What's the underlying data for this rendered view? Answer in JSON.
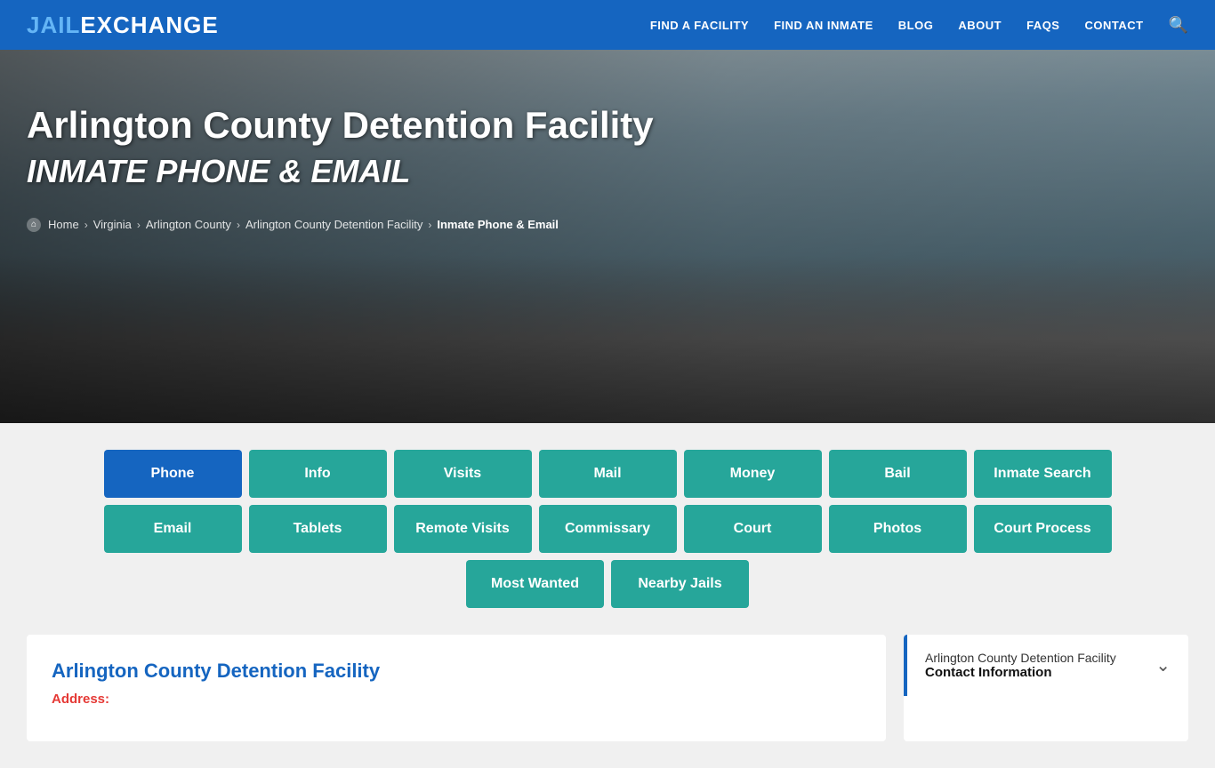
{
  "header": {
    "logo_part1": "JAIL",
    "logo_part2": "EXCHANGE",
    "nav_items": [
      {
        "label": "FIND A FACILITY",
        "href": "#"
      },
      {
        "label": "FIND AN INMATE",
        "href": "#"
      },
      {
        "label": "BLOG",
        "href": "#"
      },
      {
        "label": "ABOUT",
        "href": "#"
      },
      {
        "label": "FAQs",
        "href": "#"
      },
      {
        "label": "CONTACT",
        "href": "#"
      }
    ]
  },
  "hero": {
    "title_main": "Arlington County Detention Facility",
    "title_italic": "INMATE PHONE & EMAIL",
    "breadcrumbs": [
      {
        "label": "Home",
        "href": "#"
      },
      {
        "label": "Virginia",
        "href": "#"
      },
      {
        "label": "Arlington County",
        "href": "#"
      },
      {
        "label": "Arlington County Detention Facility",
        "href": "#"
      },
      {
        "label": "Inmate Phone & Email",
        "active": true
      }
    ]
  },
  "nav_buttons": {
    "row1": [
      {
        "label": "Phone",
        "active": true
      },
      {
        "label": "Info",
        "active": false
      },
      {
        "label": "Visits",
        "active": false
      },
      {
        "label": "Mail",
        "active": false
      },
      {
        "label": "Money",
        "active": false
      },
      {
        "label": "Bail",
        "active": false
      },
      {
        "label": "Inmate Search",
        "active": false
      }
    ],
    "row2": [
      {
        "label": "Email",
        "active": false
      },
      {
        "label": "Tablets",
        "active": false
      },
      {
        "label": "Remote Visits",
        "active": false
      },
      {
        "label": "Commissary",
        "active": false
      },
      {
        "label": "Court",
        "active": false
      },
      {
        "label": "Photos",
        "active": false
      },
      {
        "label": "Court Process",
        "active": false
      }
    ],
    "row3": [
      {
        "label": "Most Wanted",
        "active": false
      },
      {
        "label": "Nearby Jails",
        "active": false
      }
    ]
  },
  "facility_card": {
    "title": "Arlington County Detention Facility",
    "address_label": "Address:"
  },
  "contact_info_card": {
    "facility_name": "Arlington County Detention Facility",
    "section_title": "Contact Information"
  }
}
